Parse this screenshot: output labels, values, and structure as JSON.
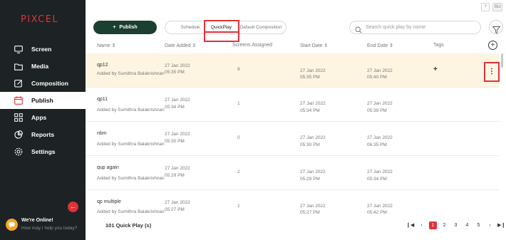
{
  "app": {
    "logo": "PIXCEL"
  },
  "sidebar": {
    "items": [
      {
        "label": "Screen",
        "icon": "monitor-icon"
      },
      {
        "label": "Media",
        "icon": "folder-icon"
      },
      {
        "label": "Composition",
        "icon": "edit-icon"
      },
      {
        "label": "Publish",
        "icon": "calendar-icon"
      },
      {
        "label": "Apps",
        "icon": "grid-icon"
      },
      {
        "label": "Reports",
        "icon": "pie-chart-icon"
      },
      {
        "label": "Settings",
        "icon": "gear-icon"
      }
    ],
    "active": "Publish"
  },
  "topbar": {
    "help": "?",
    "user": "SU"
  },
  "toolbar": {
    "publish_label": "Publish",
    "tabs": [
      "Schedule",
      "QuickPlay",
      "Default Composition"
    ],
    "active_tab": "QuickPlay",
    "search_placeholder": "Search quick play by name"
  },
  "table": {
    "headers": {
      "name": "Name",
      "date_added": "Date Added",
      "screens": "Screens Assigned",
      "start": "Start Date",
      "end": "End Date",
      "tags": "Tags"
    },
    "rows": [
      {
        "name": "qp12",
        "by": "Added by Sumithra Balakrishnan",
        "added_date": "27 Jan 2022",
        "added_time": "05:35 PM",
        "screens": "9",
        "start_date": "27 Jan 2022",
        "start_time": "05:35 PM",
        "end_date": "27 Jan 2022",
        "end_time": "05:40 PM",
        "tag": "+"
      },
      {
        "name": "qp11",
        "by": "Added by Sumithra Balakrishnan",
        "added_date": "27 Jan 2022",
        "added_time": "05:34 PM",
        "screens": "1",
        "start_date": "27 Jan 2022",
        "start_time": "05:34 PM",
        "end_date": "27 Jan 2022",
        "end_time": "05:39 PM",
        "tag": ""
      },
      {
        "name": "nbm",
        "by": "Added by Sumithra Balakrishnan",
        "added_date": "27 Jan 2022",
        "added_time": "05:30 PM",
        "screens": "0",
        "start_date": "27 Jan 2022",
        "start_time": "05:30 PM",
        "end_date": "27 Jan 2022",
        "end_time": "06:35 PM",
        "tag": ""
      },
      {
        "name": "qup again",
        "by": "Added by Sumithra Balakrishnan",
        "added_date": "27 Jan 2022",
        "added_time": "05:29 PM",
        "screens": "2",
        "start_date": "27 Jan 2022",
        "start_time": "05:29 PM",
        "end_date": "27 Jan 2022",
        "end_time": "05:34 PM",
        "tag": ""
      },
      {
        "name": "qp multiple",
        "by": "Added by Sumithra Balakrishnan",
        "added_date": "27 Jan 2022",
        "added_time": "05:27 PM",
        "screens": "1",
        "start_date": "27 Jan 2022",
        "start_time": "05:27 PM",
        "end_date": "27 Jan 2022",
        "end_time": "05:42 PM",
        "tag": ""
      }
    ]
  },
  "footer": {
    "count": "101 Quick Play (s)",
    "pages": [
      "1",
      "2",
      "3",
      "4",
      "5"
    ],
    "current_page": "1"
  },
  "chat": {
    "title": "We're Online!",
    "subtitle": "How may I help you today?"
  },
  "colors": {
    "sidebar": "#1d2224",
    "accent": "#e0323a",
    "publish": "#1b3f30",
    "highlight_row": "#fdf5e2"
  }
}
